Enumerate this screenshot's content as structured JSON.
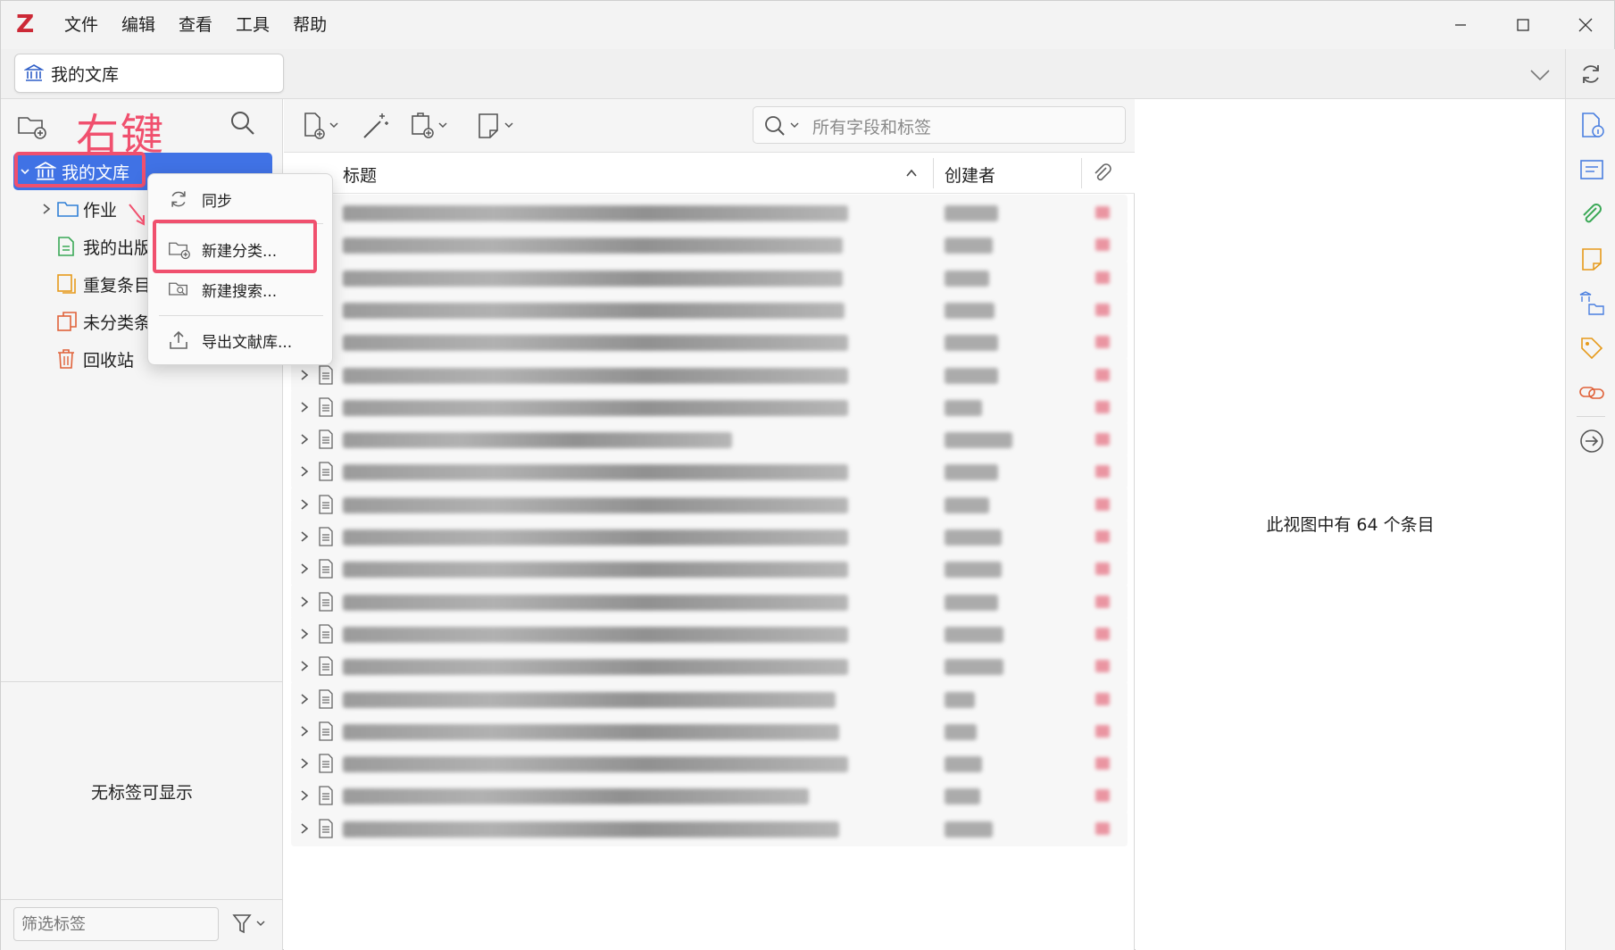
{
  "app": {
    "logo_letter": "Z",
    "menu": [
      "文件",
      "编辑",
      "查看",
      "工具",
      "帮助"
    ]
  },
  "tab": {
    "label": "我的文库"
  },
  "annotations": {
    "right_click_hint": "右键"
  },
  "collections": [
    {
      "label": "我的文库",
      "icon": "library-icon",
      "selected": true
    },
    {
      "label": "作业",
      "icon": "folder-icon"
    },
    {
      "label": "我的出版",
      "icon": "my-publications-icon"
    },
    {
      "label": "重复条目",
      "icon": "duplicate-items-icon"
    },
    {
      "label": "未分类条",
      "icon": "unfiled-items-icon"
    },
    {
      "label": "回收站",
      "icon": "trash-icon"
    }
  ],
  "context_menu": [
    {
      "label": "同步",
      "icon": "sync-icon"
    },
    {
      "label": "新建分类...",
      "icon": "new-collection-icon",
      "highlighted": true
    },
    {
      "label": "新建搜索...",
      "icon": "new-saved-search-icon"
    },
    {
      "label": "导出文献库...",
      "icon": "export-icon"
    }
  ],
  "tags": {
    "empty_text": "无标签可显示",
    "filter_placeholder": "筛选标签"
  },
  "search": {
    "placeholder": "所有字段和标签"
  },
  "columns": {
    "title": "标题",
    "creator": "创建者"
  },
  "items": [
    {
      "blurred": true
    },
    {
      "blurred": true
    },
    {
      "blurred": true
    },
    {
      "blurred": true
    },
    {
      "blurred": true
    },
    {
      "blurred": true
    },
    {
      "blurred": true
    },
    {
      "blurred": true
    },
    {
      "blurred": true
    },
    {
      "blurred": true
    },
    {
      "blurred": true
    },
    {
      "blurred": true
    },
    {
      "blurred": true
    },
    {
      "blurred": true
    },
    {
      "blurred": true
    },
    {
      "blurred": true
    },
    {
      "blurred": true
    },
    {
      "blurred": true
    },
    {
      "blurred": true
    },
    {
      "blurred": true
    }
  ],
  "item_pane": {
    "count_text": "此视图中有 64 个条目"
  },
  "colors": {
    "accent": "#4072e5",
    "annotation": "#f0506e",
    "brand": "#cc2936"
  }
}
